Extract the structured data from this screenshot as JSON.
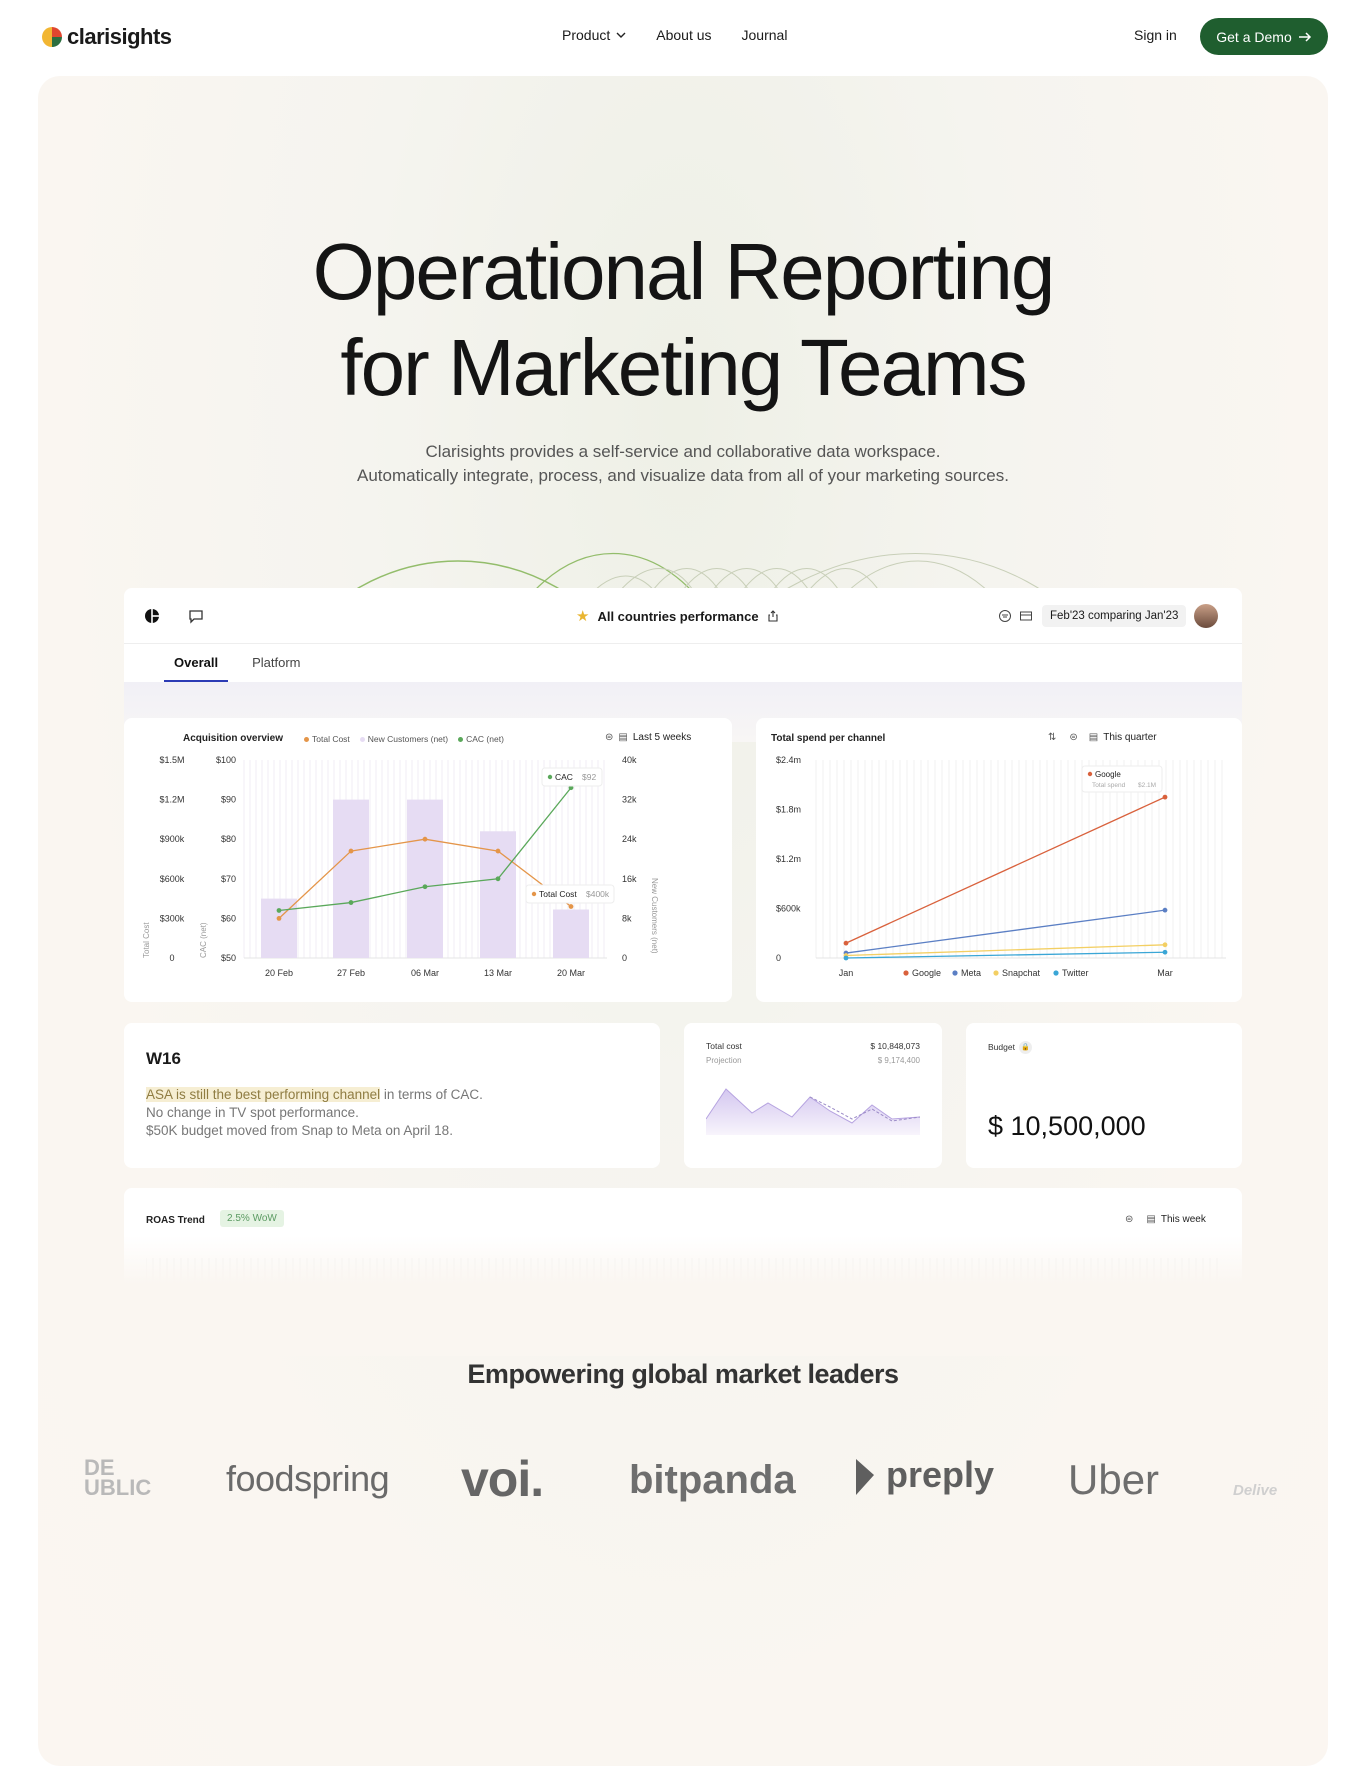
{
  "nav": {
    "logo_text": "clarisights",
    "links": [
      "Product",
      "About us",
      "Journal"
    ],
    "sign_in": "Sign in",
    "demo_label": "Get a Demo"
  },
  "hero": {
    "title_line1": "Operational Reporting",
    "title_line2": "for Marketing Teams",
    "sub_line1": "Clarisights provides a self-service and collaborative data workspace.",
    "sub_line2": "Automatically integrate, process, and visualize data from all of your marketing sources."
  },
  "dashboard": {
    "title": "All countries performance",
    "date_range": "Feb'23 comparing Jan'23",
    "tabs": [
      "Overall",
      "Platform"
    ],
    "acquisition": {
      "title": "Acquisition overview",
      "legend": [
        "Total Cost",
        "New Customers (net)",
        "CAC (net)"
      ],
      "range": "Last 5 weeks",
      "y_left1": [
        "$1.5M",
        "$1.2M",
        "$900k",
        "$600k",
        "$300k",
        "0"
      ],
      "y_left2": [
        "$100",
        "$90",
        "$80",
        "$70",
        "$60",
        "$50"
      ],
      "y_right": [
        "40k",
        "32k",
        "24k",
        "16k",
        "8k",
        "0"
      ],
      "y_left1_title": "Total Cost",
      "y_left2_title": "CAC (net)",
      "y_right_title": "New Customers (net)",
      "tooltip_cac_label": "CAC",
      "tooltip_cac_value": "$92",
      "tooltip_cost_label": "Total Cost",
      "tooltip_cost_value": "$400k"
    },
    "spend": {
      "title": "Total spend per channel",
      "range": "This quarter",
      "y_ticks": [
        "$2.4m",
        "$1.8m",
        "$1.2m",
        "$600k",
        "0"
      ],
      "tooltip_label": "Google",
      "tooltip_sub": "Total spend",
      "tooltip_value": "$2.1M",
      "x_first": "Jan",
      "x_last": "Mar",
      "legend": [
        "Google",
        "Meta",
        "Snapchat",
        "Twitter"
      ]
    },
    "note": {
      "title": "W16",
      "line1_hl": "ASA is still the best performing channel",
      "line1_rest": " in terms of CAC.",
      "line2": "No change in TV spot performance.",
      "line3": "$50K budget moved from Snap to Meta on April 18."
    },
    "cost": {
      "label": "Total cost",
      "value": "$ 10,848,073",
      "proj_label": "Projection",
      "proj_value": "$ 9,174,400"
    },
    "budget": {
      "label": "Budget",
      "value": "$ 10,500,000"
    },
    "roas": {
      "title": "ROAS Trend",
      "badge": "2.5% WoW",
      "range": "This week"
    }
  },
  "leaders": {
    "title": "Empowering global market leaders",
    "brands": [
      "DE \nUBLIC",
      "foodspring",
      "voi.",
      "bitpanda",
      "preply",
      "Uber",
      "Delive"
    ]
  },
  "colors": {
    "accent": "#1f5e2f",
    "google": "#d9613c",
    "meta": "#5b7fc4",
    "snapchat": "#f3cf63",
    "twitter": "#3aa6d6",
    "bar": "#e6dcf3",
    "cac": "#5aa85a",
    "cost": "#e49549"
  },
  "chart_data": [
    {
      "type": "bar",
      "title": "Acquisition overview",
      "categories": [
        "20 Feb",
        "27 Feb",
        "06 Mar",
        "13 Mar",
        "20 Mar"
      ],
      "series": [
        {
          "name": "New Customers (net)",
          "axis": "right",
          "values": [
            12000,
            32000,
            32000,
            25600,
            9800
          ]
        },
        {
          "name": "Total Cost",
          "axis": "left1",
          "values": [
            300000,
            810000,
            900000,
            810000,
            390000
          ]
        },
        {
          "name": "CAC (net)",
          "axis": "left2",
          "values": [
            62,
            64,
            68,
            70,
            93
          ]
        }
      ],
      "ylim_left1": [
        0,
        1500000
      ],
      "ylim_left2": [
        50,
        100
      ],
      "ylim_right": [
        0,
        40000
      ]
    },
    {
      "type": "line",
      "title": "Total spend per channel",
      "x": [
        "Jan",
        "Mar"
      ],
      "series": [
        {
          "name": "Google",
          "values": [
            180000,
            1950000
          ]
        },
        {
          "name": "Meta",
          "values": [
            60000,
            580000
          ]
        },
        {
          "name": "Snapchat",
          "values": [
            30000,
            160000
          ]
        },
        {
          "name": "Twitter",
          "values": [
            0,
            70000
          ]
        }
      ],
      "ylim": [
        0,
        2400000
      ]
    }
  ]
}
